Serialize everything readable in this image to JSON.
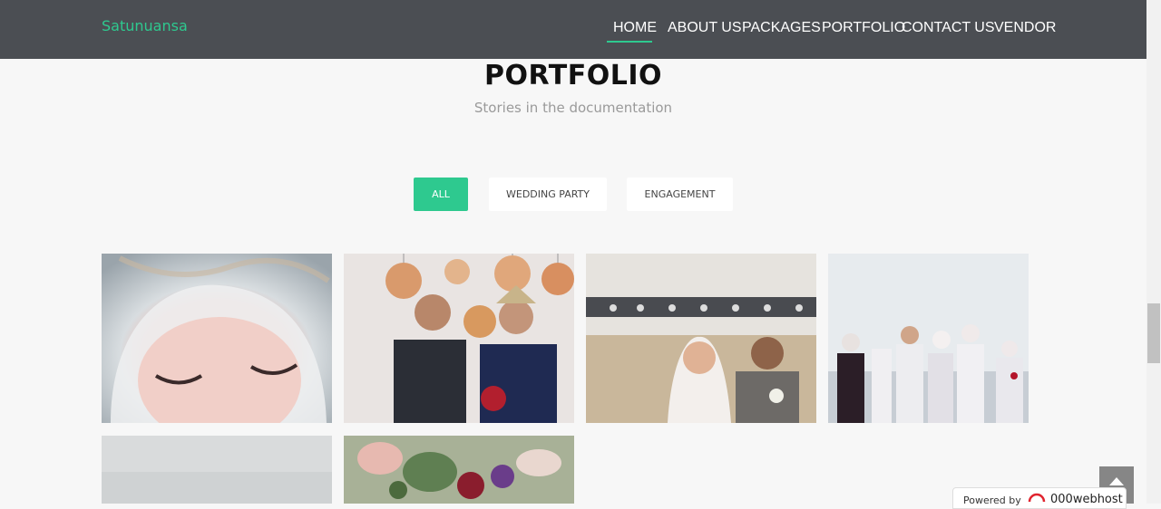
{
  "header": {
    "brand": "Satunuansa",
    "nav": [
      "HOME",
      "ABOUT US",
      "PACKAGES",
      "PORTFOLIO",
      "CONTACT US",
      "VENDOR"
    ],
    "active": "HOME",
    "accent_color": "#2ec98f",
    "bg_color": "#4b4e53"
  },
  "section": {
    "title": "PORTFOLIO",
    "subtitle": "Stories in the documentation"
  },
  "filters": [
    "ALL",
    "WEDDING PARTY",
    "ENGAGEMENT"
  ],
  "active_filter": "ALL",
  "gallery": [
    "bride-veil-closeup-photo",
    "couple-under-lamps-photo",
    "couple-ballroom-photo",
    "group-ceremony-outdoor-photo",
    "misty-landscape-photo",
    "floral-bouquet-photo"
  ],
  "footer_badge": {
    "powered_by": "Powered by",
    "host": "000webhost"
  }
}
